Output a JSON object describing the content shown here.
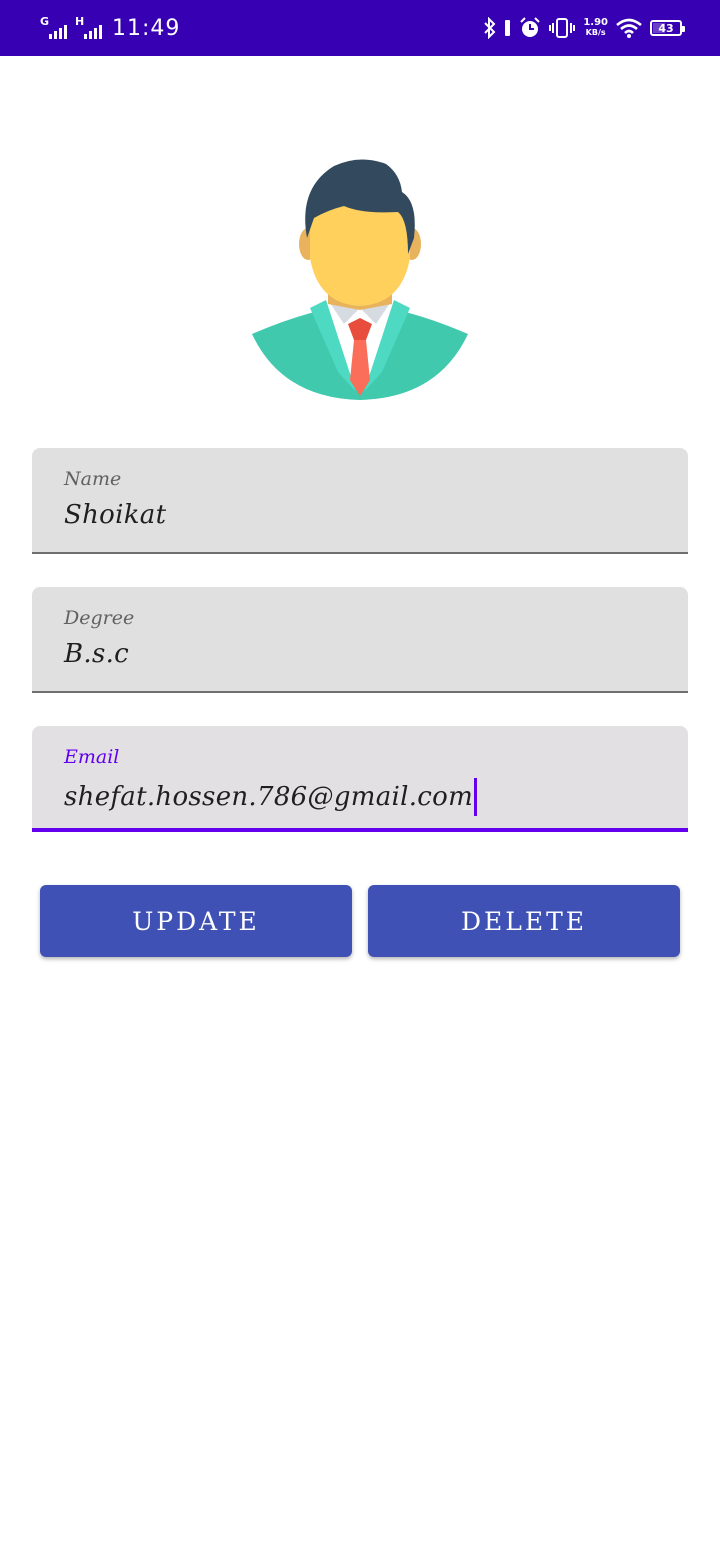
{
  "status_bar": {
    "net1": "G",
    "net2": "H",
    "time": "11:49",
    "speed_value": "1.90",
    "speed_unit": "KB/s",
    "battery_level": "43"
  },
  "form": {
    "name": {
      "label": "Name",
      "value": "Shoikat"
    },
    "degree": {
      "label": "Degree",
      "value": "B.s.c"
    },
    "email": {
      "label": "Email",
      "value": "shefat.hossen.786@gmail.com"
    }
  },
  "buttons": {
    "update": "UPDATE",
    "delete": "DELETE"
  },
  "colors": {
    "status_bar": "#3700b3",
    "accent": "#6200ee",
    "button": "#3f51b5",
    "field_bg": "#e0e0e0"
  }
}
